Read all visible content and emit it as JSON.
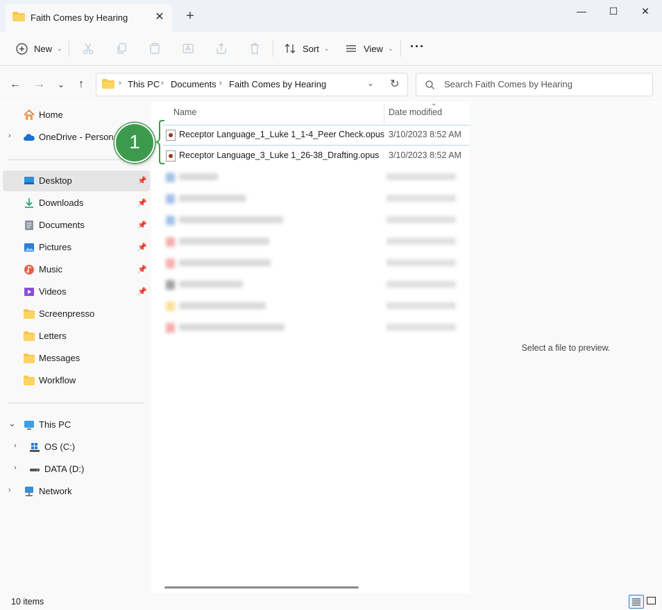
{
  "window": {
    "tab_title": "Faith Comes by Hearing",
    "tab_close": "✕",
    "new_tab": "+",
    "minimize": "—",
    "maximize": "☐",
    "close": "✕"
  },
  "toolbar": {
    "new_label": "New",
    "sort_label": "Sort",
    "view_label": "View",
    "more_label": "···"
  },
  "address": {
    "crumbs": [
      "This PC",
      "Documents",
      "Faith Comes by Hearing"
    ],
    "search_placeholder": "Search Faith Comes by Hearing"
  },
  "sidebar": {
    "home": "Home",
    "onedrive": "OneDrive - Personal",
    "pinned": [
      {
        "label": "Desktop",
        "icon": "desktop-icon"
      },
      {
        "label": "Downloads",
        "icon": "download-icon"
      },
      {
        "label": "Documents",
        "icon": "document-icon"
      },
      {
        "label": "Pictures",
        "icon": "picture-icon"
      },
      {
        "label": "Music",
        "icon": "music-icon"
      },
      {
        "label": "Videos",
        "icon": "video-icon"
      }
    ],
    "folders": [
      "Screenpresso",
      "Letters",
      "Messages",
      "Workflow"
    ],
    "this_pc": "This PC",
    "drives": [
      "OS (C:)",
      "DATA (D:)"
    ],
    "network": "Network"
  },
  "columns": {
    "name": "Name",
    "date_modified": "Date modified"
  },
  "files": [
    {
      "name": "Receptor Language_1_Luke 1_1-4_Peer Check.opus",
      "date": "3/10/2023 8:52 AM"
    },
    {
      "name": "Receptor Language_3_Luke 1_26-38_Drafting.opus",
      "date": "3/10/2023 8:52 AM"
    }
  ],
  "callout": {
    "number": "1"
  },
  "preview": {
    "text": "Select a file to preview."
  },
  "status": {
    "count": "10 items"
  },
  "colors": {
    "accent": "#0067c0",
    "callout_green": "#3d9a4c",
    "folder_yellow": "#f7c748",
    "selected_bg": "#e5e5e5"
  }
}
